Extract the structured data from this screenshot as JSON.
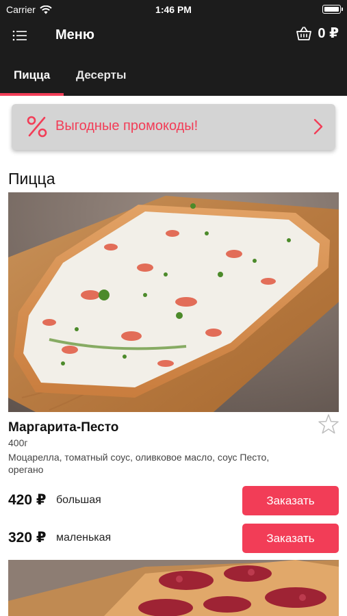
{
  "status_bar": {
    "carrier": "Carrier",
    "time": "1:46 PM"
  },
  "nav": {
    "title": "Меню",
    "cart_amount": "0 ₽"
  },
  "tabs": [
    {
      "label": "Пицца",
      "active": true
    },
    {
      "label": "Десерты",
      "active": false
    }
  ],
  "promo": {
    "text": "Выгодные промокоды!"
  },
  "section": {
    "title": "Пицца"
  },
  "product": {
    "name": "Маргарита-Песто",
    "weight": "400г",
    "description": "Моцарелла, томатный соус, оливковое масло, соус Песто, орегано",
    "options": [
      {
        "price": "420 ₽",
        "size": "большая",
        "button": "Заказать"
      },
      {
        "price": "320 ₽",
        "size": "маленькая",
        "button": "Заказать"
      }
    ]
  },
  "colors": {
    "accent": "#f23d57",
    "bar": "#1c1c1c",
    "promo_bg": "#d4d4d4"
  }
}
